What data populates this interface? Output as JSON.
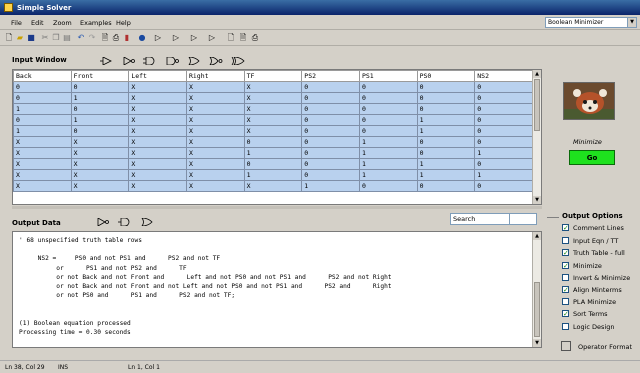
{
  "window": {
    "title": "Simple Solver"
  },
  "menu": [
    "File",
    "Edit",
    "Zoom",
    "Examples",
    "Help"
  ],
  "mode_select": {
    "value": "Boolean Minimizer"
  },
  "toolbar_icons": [
    "new-file-icon",
    "open-folder-icon",
    "save-icon",
    "cut-icon",
    "copy-icon",
    "paste-icon",
    "undo-icon",
    "redo-icon",
    "print-preview-icon",
    "print-icon",
    "delete-icon",
    "help-icon",
    "gate-icon",
    "gate-icon",
    "gate-icon",
    "gate-icon",
    "page-icon",
    "print-preview-icon",
    "print-icon"
  ],
  "input_window": {
    "label": "Input Window",
    "columns": [
      "Back",
      "Front",
      "Left",
      "Right",
      "TF",
      "PS2",
      "PS1",
      "PS0",
      "NS2"
    ],
    "rows": [
      [
        "0",
        "0",
        "X",
        "X",
        "X",
        "0",
        "0",
        "0",
        "0"
      ],
      [
        "0",
        "1",
        "X",
        "X",
        "X",
        "0",
        "0",
        "0",
        "0"
      ],
      [
        "1",
        "0",
        "X",
        "X",
        "X",
        "0",
        "0",
        "0",
        "0"
      ],
      [
        "0",
        "1",
        "X",
        "X",
        "X",
        "0",
        "0",
        "1",
        "0"
      ],
      [
        "1",
        "0",
        "X",
        "X",
        "X",
        "0",
        "0",
        "1",
        "0"
      ],
      [
        "X",
        "X",
        "X",
        "X",
        "0",
        "0",
        "1",
        "0",
        "0"
      ],
      [
        "X",
        "X",
        "X",
        "X",
        "1",
        "0",
        "1",
        "0",
        "1"
      ],
      [
        "X",
        "X",
        "X",
        "X",
        "0",
        "0",
        "1",
        "1",
        "0"
      ],
      [
        "X",
        "X",
        "X",
        "X",
        "1",
        "0",
        "1",
        "1",
        "1"
      ],
      [
        "X",
        "X",
        "X",
        "X",
        "X",
        "1",
        "0",
        "0",
        "0"
      ]
    ]
  },
  "output_data": {
    "label": "Output Data",
    "search_placeholder": "Search",
    "text": "' 68 unspecified truth table rows\n\n     NS2 =     PS0 and not PS1 and      PS2 and not TF\n          or      PS1 and not PS2 and      TF\n          or not Back and not Front and      Left and not PS0 and not PS1 and      PS2 and not Right\n          or not Back and not Front and not Left and not PS0 and not PS1 and      PS2 and      Right\n          or not PS0 and      PS1 and      PS2 and not TF;\n\n\n(1) Boolean equation processed\nProcessing time = 0.30 seconds"
  },
  "right_panel": {
    "minimize_label": "Minimize",
    "go_label": "Go"
  },
  "output_options": {
    "title": "Output Options",
    "items": [
      {
        "label": "Comment Lines",
        "checked": true
      },
      {
        "label": "Input Eqn / TT",
        "checked": false
      },
      {
        "label": "Truth Table - full",
        "checked": true
      },
      {
        "label": "Minimize",
        "checked": true
      },
      {
        "label": "Invert & Minimize",
        "checked": false
      },
      {
        "label": "Align Minterms",
        "checked": true
      },
      {
        "label": "PLA Minimize",
        "checked": false
      },
      {
        "label": "Sort Terms",
        "checked": true
      },
      {
        "label": "Logic Design",
        "checked": false
      }
    ],
    "format_label": "Operator Format"
  },
  "status": {
    "position": "Ln 38, Col 29",
    "mode": "INS",
    "secondary": "Ln 1, Col 1"
  },
  "colors": {
    "title_start": "#3a6ea5",
    "title_end": "#0a246a",
    "grid_cell": "#b9d1ee",
    "go_button": "#1ee11e"
  }
}
